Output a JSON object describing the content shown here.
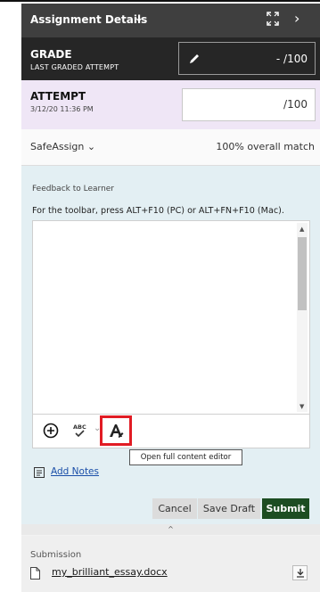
{
  "header": {
    "title": "Assignment Details"
  },
  "grade": {
    "label": "GRADE",
    "sublabel": "LAST GRADED ATTEMPT",
    "value": "- /100"
  },
  "attempt": {
    "label": "ATTEMPT",
    "date": "3/12/20 11:36 PM",
    "value": "/100"
  },
  "safeassign": {
    "label": "SafeAssign",
    "match": "100% overall match"
  },
  "feedback": {
    "label": "Feedback to Learner",
    "hint": "For the toolbar, press ALT+F10 (PC) or ALT+FN+F10 (Mac).",
    "tooltip": "Open full content editor"
  },
  "notes": {
    "link": "Add Notes"
  },
  "actions": {
    "cancel": "Cancel",
    "save_draft": "Save Draft",
    "submit": "Submit"
  },
  "submission": {
    "label": "Submission",
    "file": "my_brilliant_essay.docx"
  },
  "icons": {
    "header_chevron": "chevron-down-icon",
    "expand": "expand-icon",
    "next": "chevron-right-icon",
    "pencil": "pencil-icon",
    "add": "plus-circle-icon",
    "spellcheck": "spellcheck-icon",
    "editor": "full-editor-icon",
    "notes": "notes-icon",
    "file": "file-icon",
    "download": "download-icon"
  },
  "colors": {
    "header_bg": "#3f3f3f",
    "grade_bg": "#262626",
    "attempt_bg": "#efe6f6",
    "feedback_bg": "#e3eff3",
    "submit_bg": "#1d4d22",
    "highlight": "#e11c24",
    "link": "#1a4ea8"
  }
}
